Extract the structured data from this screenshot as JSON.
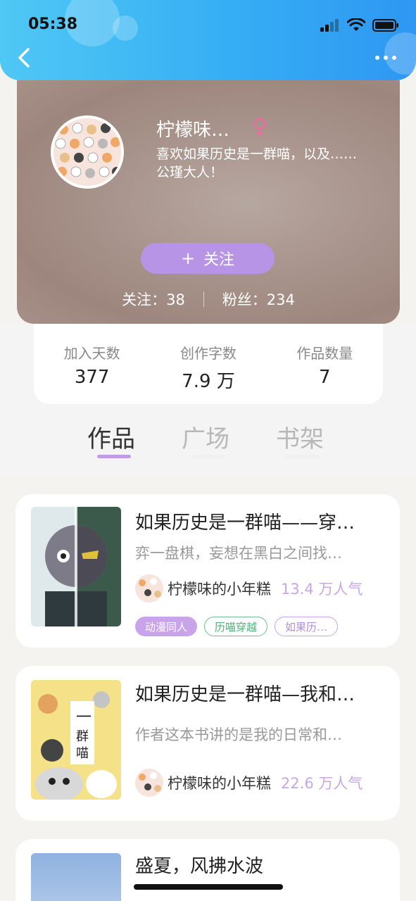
{
  "status_bar": {
    "time": "05:38"
  },
  "profile": {
    "username": "柠檬味…",
    "bio": "喜欢如果历史是一群喵，以及……公瑾大人！",
    "follow_plus": "+",
    "follow_label": "关注",
    "following": "关注：38",
    "fans": "粉丝：234"
  },
  "stats": [
    {
      "label": "加入天数",
      "value": "377"
    },
    {
      "label": "创作字数",
      "value": "7.9 万"
    },
    {
      "label": "作品数量",
      "value": "7"
    }
  ],
  "tabs": [
    {
      "label": "作品"
    },
    {
      "label": "广场"
    },
    {
      "label": "书架"
    }
  ],
  "books": [
    {
      "title": "如果历史是一群喵——穿…",
      "desc": "弈一盘棋，妄想在黑白之间找…",
      "author": "柠檬味的小年糕",
      "popularity": "13.4 万人气",
      "tags": [
        "动漫同人",
        "历喵穿越",
        "如果历…"
      ]
    },
    {
      "title": "如果历史是一群喵—我和…",
      "desc": "作者这本书讲的是我的日常和…",
      "author": "柠檬味的小年糕",
      "popularity": "22.6 万人气"
    },
    {
      "title": "盛夏，风拂水波"
    }
  ],
  "colors": {
    "header_blue": "#36aef4",
    "accent_purple": "#c49ae6",
    "tag_green": "#4eae78"
  }
}
